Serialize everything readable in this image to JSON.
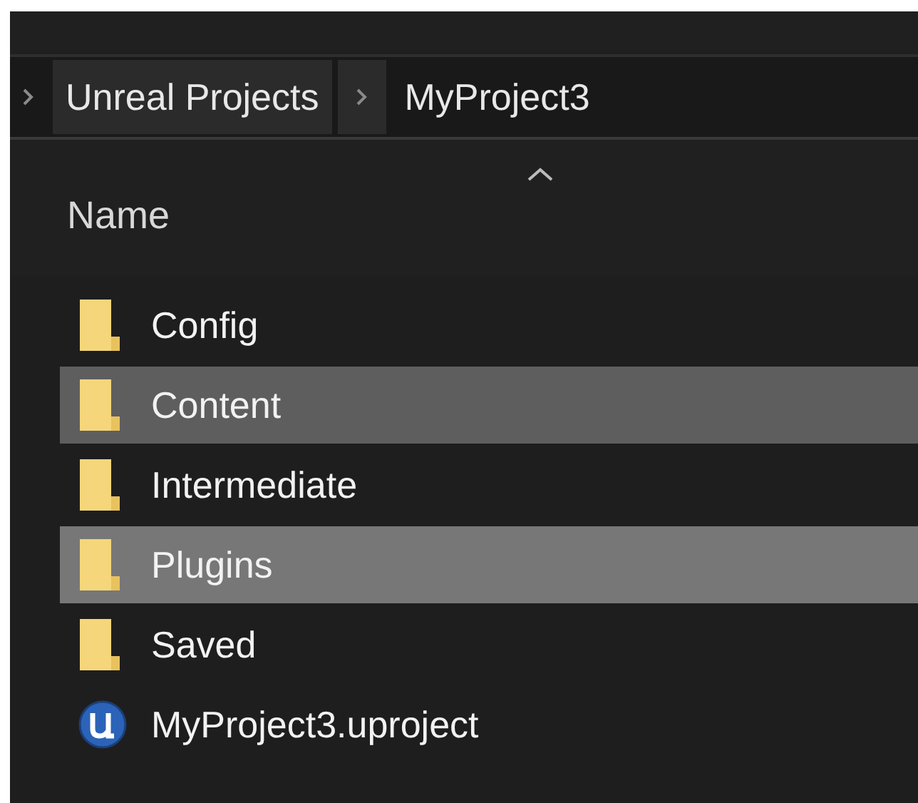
{
  "breadcrumb": [
    {
      "label": "Unreal Projects",
      "hovered": true
    },
    {
      "label": "MyProject3",
      "hovered": false
    }
  ],
  "columns": [
    {
      "label": "Name",
      "sorted": true
    }
  ],
  "files": [
    {
      "name": "Config",
      "kind": "folder",
      "selected": false,
      "hovered": false
    },
    {
      "name": "Content",
      "kind": "folder",
      "selected": true,
      "hovered": false
    },
    {
      "name": "Intermediate",
      "kind": "folder",
      "selected": false,
      "hovered": false
    },
    {
      "name": "Plugins",
      "kind": "folder",
      "selected": true,
      "hovered": true
    },
    {
      "name": "Saved",
      "kind": "folder",
      "selected": false,
      "hovered": false
    },
    {
      "name": "MyProject3.uproject",
      "kind": "project",
      "selected": false,
      "hovered": false
    }
  ]
}
